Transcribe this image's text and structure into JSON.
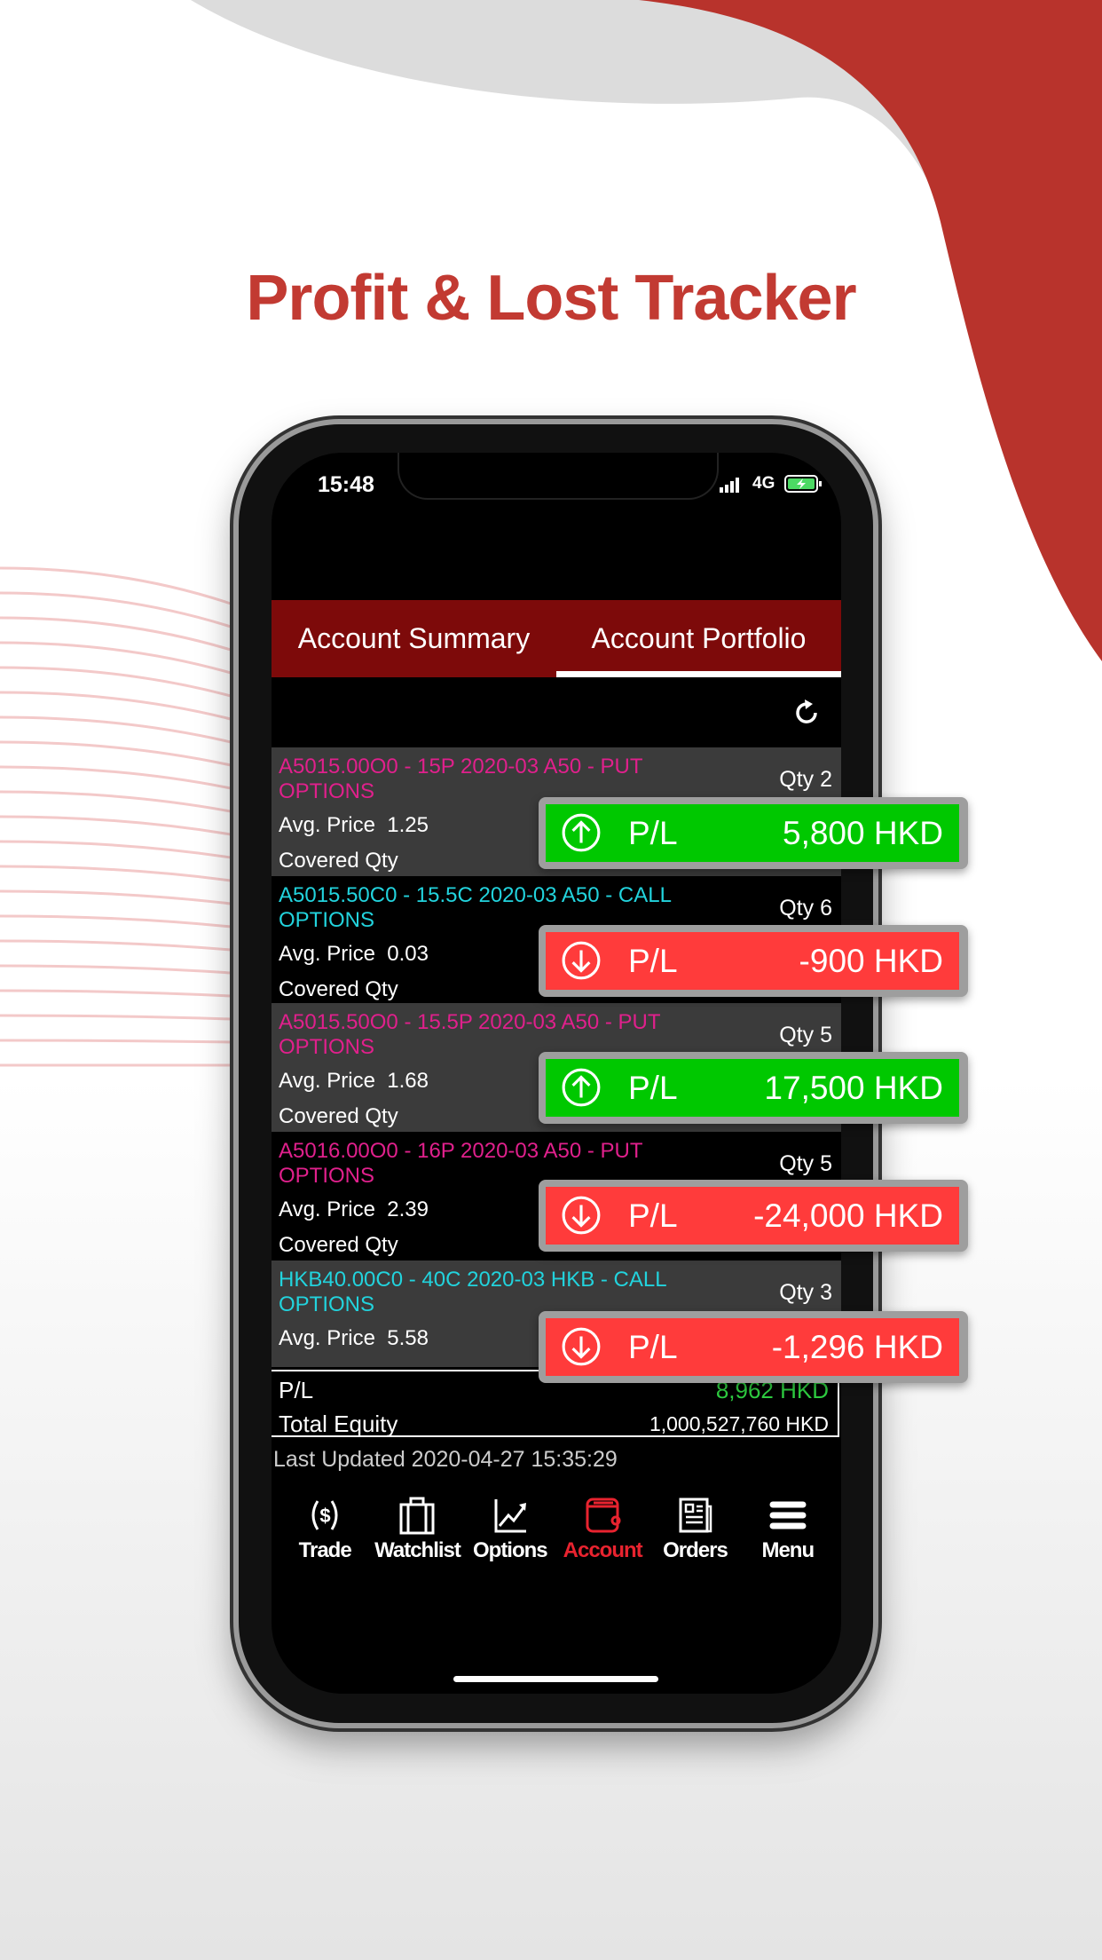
{
  "headline": "Profit & Lost Tracker",
  "colors": {
    "brand": "#c23a32",
    "profit": "#00c800",
    "loss": "#ff3b3b",
    "put": "#e0208c",
    "call": "#22d3dd",
    "active_nav": "#e8232f"
  },
  "status_bar": {
    "time": "15:48",
    "network": "4G"
  },
  "tabs": [
    {
      "label": "Account Summary",
      "active": false
    },
    {
      "label": "Account Portfolio",
      "active": true
    }
  ],
  "positions": [
    {
      "title": "A5015.00O0 - 15P 2020-03 A50 - PUT OPTIONS",
      "type": "put",
      "qty": "Qty 2",
      "avg_label": "Avg. Price",
      "avg": "1.25",
      "covered": "Covered Qty",
      "pl_label": "P/L",
      "pl": "5,800 HKD",
      "direction": "up"
    },
    {
      "title": "A5015.50C0 - 15.5C 2020-03 A50 - CALL OPTIONS",
      "type": "call",
      "qty": "Qty 6",
      "avg_label": "Avg. Price",
      "avg": "0.03",
      "covered": "Covered Qty",
      "pl_label": "P/L",
      "pl": "-900 HKD",
      "direction": "down"
    },
    {
      "title": "A5015.50O0 - 15.5P 2020-03 A50 - PUT OPTIONS",
      "type": "put",
      "qty": "Qty 5",
      "avg_label": "Avg. Price",
      "avg": "1.68",
      "covered": "Covered Qty",
      "pl_label": "P/L",
      "pl": "17,500 HKD",
      "direction": "up"
    },
    {
      "title": "A5016.00O0 - 16P 2020-03 A50 - PUT OPTIONS",
      "type": "put",
      "qty": "Qty 5",
      "avg_label": "Avg. Price",
      "avg": "2.39",
      "covered": "Covered Qty",
      "pl_label": "P/L",
      "pl": "-24,000 HKD",
      "direction": "down"
    },
    {
      "title": "HKB40.00C0 - 40C 2020-03 HKB - CALL OPTIONS",
      "type": "call",
      "qty": "Qty 3",
      "avg_label": "Avg. Price",
      "avg": "5.58",
      "pl_label": "P/L",
      "pl": "-1,296 HKD",
      "direction": "down"
    }
  ],
  "summary": {
    "pl_label": "P/L",
    "pl_value": "8,962 HKD",
    "equity_label": "Total Equity",
    "equity_value": "1,000,527,760 HKD"
  },
  "last_updated": "Last Updated 2020-04-27 15:35:29",
  "nav": [
    {
      "label": "Trade",
      "icon": "dollar-cycle-icon"
    },
    {
      "label": "Watchlist",
      "icon": "briefcase-icon"
    },
    {
      "label": "Options",
      "icon": "chart-up-icon"
    },
    {
      "label": "Account",
      "icon": "wallet-icon",
      "active": true
    },
    {
      "label": "Orders",
      "icon": "newspaper-icon"
    },
    {
      "label": "Menu",
      "icon": "hamburger-icon"
    }
  ]
}
